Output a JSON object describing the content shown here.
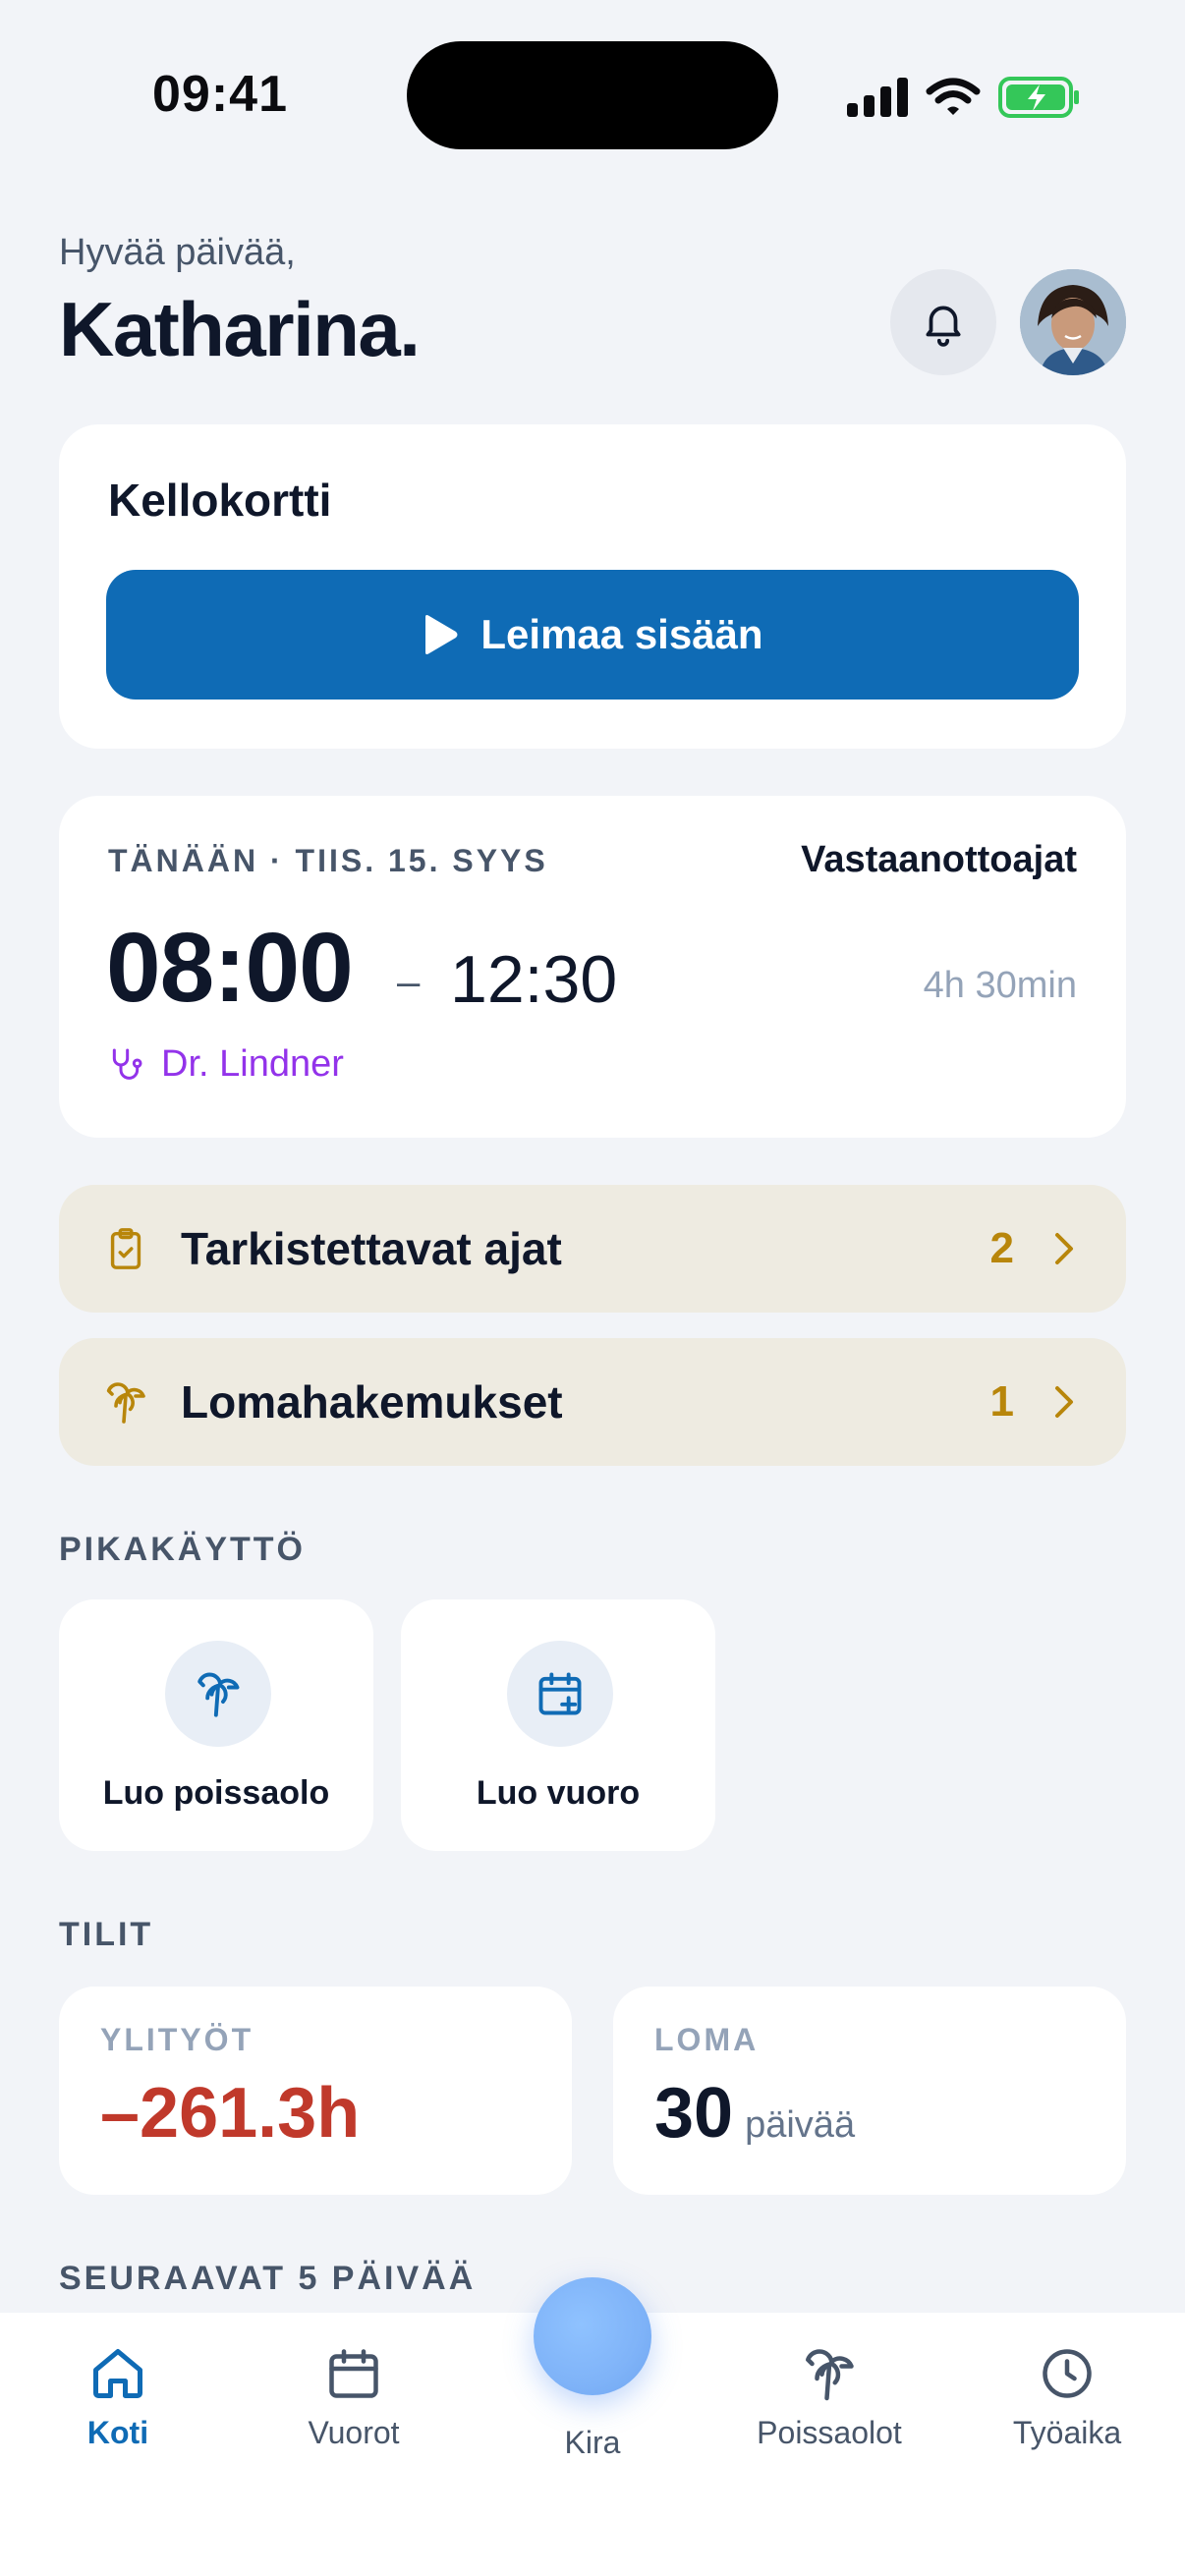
{
  "status_bar": {
    "time": "09:41"
  },
  "header": {
    "greeting": "Hyvää päivää,",
    "name": "Katharina."
  },
  "clock_card": {
    "title": "Kellokortti",
    "button_label": "Leimaa sisään"
  },
  "shift": {
    "date": "TÄNÄÄN · TIIS. 15. SYYS",
    "type": "Vastaanottoajat",
    "start": "08:00",
    "dash": "–",
    "end": "12:30",
    "duration": "4h 30min",
    "doctor": "Dr. Lindner"
  },
  "tasks": [
    {
      "label": "Tarkistettavat ajat",
      "count": "2",
      "icon": "clipboard-check-icon"
    },
    {
      "label": "Lomahakemukset",
      "count": "1",
      "icon": "palm-tree-icon"
    }
  ],
  "quick_access": {
    "title": "PIKAKÄYTTÖ",
    "items": [
      {
        "label": "Luo poissaolo",
        "icon": "palm-tree-icon"
      },
      {
        "label": "Luo vuoro",
        "icon": "calendar-plus-icon"
      }
    ]
  },
  "accounts": {
    "title": "TILIT",
    "overtime": {
      "label": "YLITYÖT",
      "value": "–261.3h",
      "color": "#c0392b"
    },
    "vacation": {
      "label": "LOMA",
      "value": "30",
      "unit": "päivää"
    }
  },
  "upcoming": {
    "title": "SEURAAVAT 5 PÄIVÄÄ"
  },
  "nav": {
    "home": "Koti",
    "shifts": "Vuorot",
    "kira": "Kira",
    "absences": "Poissaolot",
    "worktime": "Työaika"
  },
  "colors": {
    "accent": "#0f6bb5",
    "doctor": "#9333ea",
    "task_count": "#b8860b",
    "task_bg": "#eeebe1"
  }
}
